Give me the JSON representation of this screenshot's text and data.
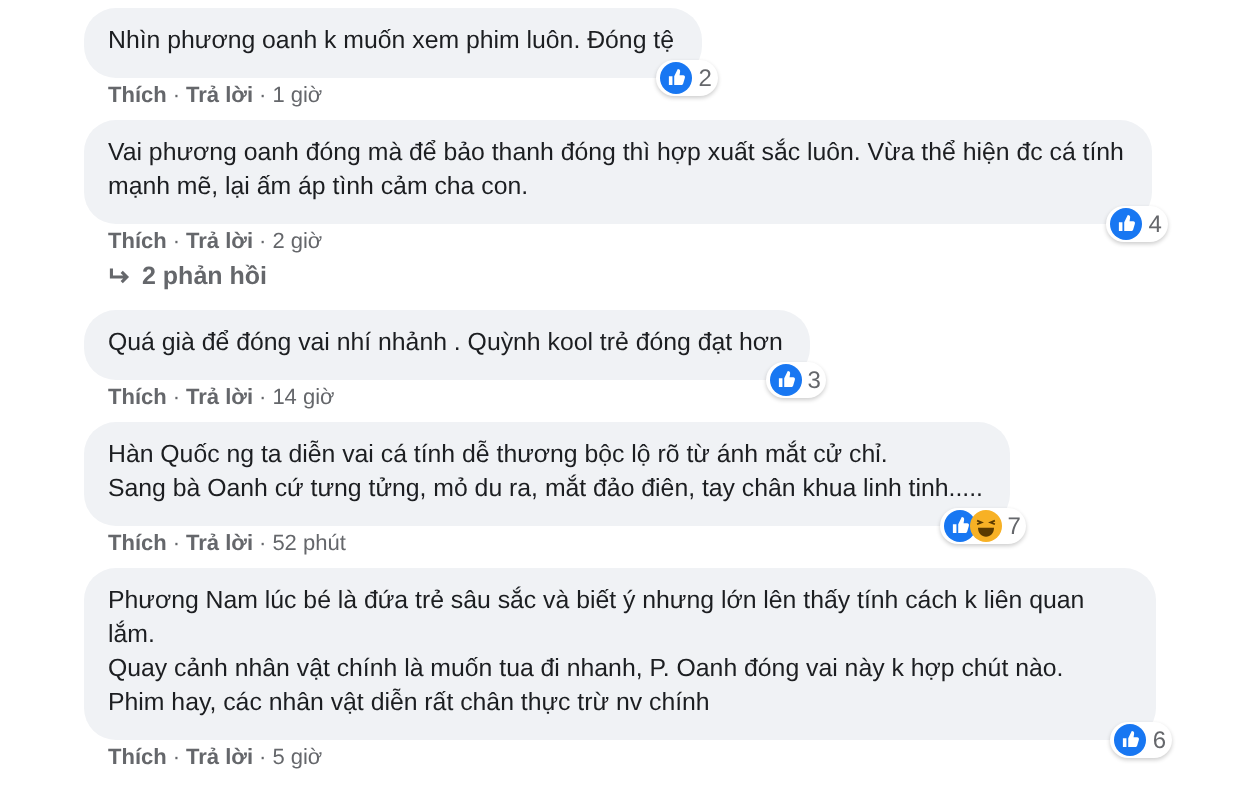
{
  "comments": [
    {
      "text": "Nhìn phương oanh k muốn xem phim luôn. Đóng tệ",
      "reactions": [
        {
          "kind": "like"
        }
      ],
      "count": "2",
      "actions": [
        "Thích",
        "Trả lời"
      ],
      "separator": "·",
      "time": "1 giờ"
    },
    {
      "text": "Vai phương oanh đóng mà để bảo thanh đóng thì hợp xuất sắc luôn. Vừa thể hiện đc cá tính\nmạnh mẽ, lại ấm áp tình cảm cha con.",
      "reactions": [
        {
          "kind": "like"
        }
      ],
      "count": "4",
      "actions": [
        "Thích",
        "Trả lời"
      ],
      "separator": "·",
      "time": "2 giờ",
      "replies": "2 phản hồi"
    },
    {
      "text": "Quá già để đóng vai nhí nhảnh . Quỳnh kool trẻ đóng đạt hơn",
      "reactions": [
        {
          "kind": "like"
        }
      ],
      "count": "3",
      "actions": [
        "Thích",
        "Trả lời"
      ],
      "separator": "·",
      "time": "14 giờ"
    },
    {
      "text": "Hàn Quốc ng ta diễn vai cá tính dễ thương bộc lộ rõ từ ánh mắt cử chỉ.\nSang bà Oanh cứ tưng tửng, mỏ du ra, mắt đảo điên, tay chân khua linh tinh.....",
      "reactions": [
        {
          "kind": "like"
        },
        {
          "kind": "haha"
        }
      ],
      "count": "7",
      "actions": [
        "Thích",
        "Trả lời"
      ],
      "separator": "·",
      "time": "52 phút"
    },
    {
      "text": "Phương Nam lúc bé là đứa trẻ sâu sắc và biết ý nhưng lớn lên thấy tính cách k liên quan lắm.\nQuay cảnh nhân vật chính là muốn tua đi nhanh, P. Oanh đóng vai này k hợp chút nào.\nPhim hay, các nhân vật diễn rất chân thực trừ nv chính",
      "reactions": [
        {
          "kind": "like"
        }
      ],
      "count": "6",
      "actions": [
        "Thích",
        "Trả lời"
      ],
      "separator": "·",
      "time": "5 giờ"
    }
  ]
}
